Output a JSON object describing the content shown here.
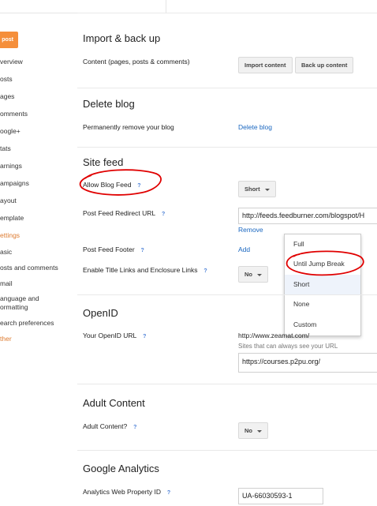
{
  "sidebar": {
    "new_post": "post",
    "items": [
      {
        "label": "verview"
      },
      {
        "label": "osts"
      },
      {
        "label": "ages"
      },
      {
        "label": "omments"
      },
      {
        "label": "oogle+"
      },
      {
        "label": "tats"
      },
      {
        "label": "arnings"
      },
      {
        "label": "ampaigns"
      },
      {
        "label": "ayout"
      },
      {
        "label": "emplate"
      },
      {
        "label": "ettings"
      },
      {
        "label": "asic"
      },
      {
        "label": "osts and comments"
      },
      {
        "label": "mail"
      },
      {
        "label": "anguage and"
      },
      {
        "label": "ormatting"
      },
      {
        "label": "earch preferences"
      },
      {
        "label": "ther"
      }
    ]
  },
  "import_backup": {
    "title": "Import & back up",
    "content_label": "Content (pages, posts & comments)",
    "import_button": "Import content",
    "backup_button": "Back up content"
  },
  "delete_blog": {
    "title": "Delete blog",
    "label": "Permanently remove your blog",
    "link": "Delete blog"
  },
  "site_feed": {
    "title": "Site feed",
    "allow_label": "Allow Blog Feed",
    "allow_value": "Short",
    "redirect_label": "Post Feed Redirect URL",
    "redirect_value": "http://feeds.feedburner.com/blogspot/H",
    "remove_link": "Remove",
    "footer_label": "Post Feed Footer",
    "footer_link": "Add",
    "title_links_label": "Enable Title Links and Enclosure Links",
    "title_links_value": "No",
    "dropdown_options": [
      "Full",
      "Until Jump Break",
      "Short",
      "None",
      "Custom"
    ]
  },
  "openid": {
    "title": "OpenID",
    "url_label": "Your OpenID URL",
    "url_value": "http://www.zeamat.com/",
    "sites_label": "Sites that can always see your URL",
    "sites_value": "https://courses.p2pu.org/"
  },
  "adult": {
    "title": "Adult Content",
    "label": "Adult Content?",
    "value": "No"
  },
  "analytics": {
    "title": "Google Analytics",
    "label": "Analytics Web Property ID",
    "value": "UA-66030593-1"
  },
  "help_glyph": "?",
  "colors": {
    "accent": "#f58f3b",
    "link": "#1a67c0",
    "annotation": "#e00000"
  }
}
